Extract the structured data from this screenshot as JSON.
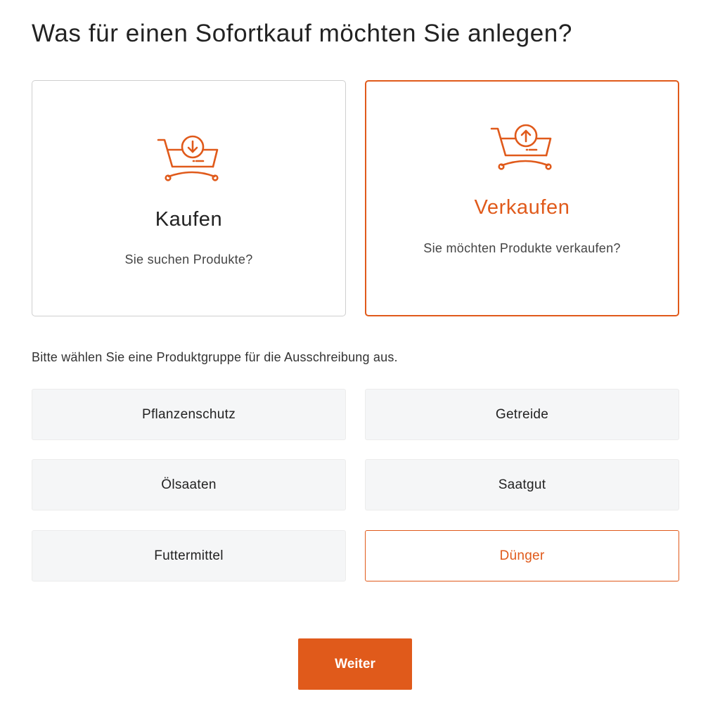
{
  "page": {
    "title": "Was für einen Sofortkauf möchten Sie anlegen?"
  },
  "options": {
    "buy": {
      "title": "Kaufen",
      "subtitle": "Sie suchen Produkte?",
      "icon": "cart-download-icon",
      "selected": false
    },
    "sell": {
      "title": "Verkaufen",
      "subtitle": "Sie möchten Produkte verkaufen?",
      "icon": "cart-upload-icon",
      "selected": true
    }
  },
  "product_groups": {
    "instruction": "Bitte wählen Sie eine Produktgruppe für die Ausschreibung aus.",
    "items": [
      {
        "label": "Pflanzenschutz",
        "selected": false
      },
      {
        "label": "Getreide",
        "selected": false
      },
      {
        "label": "Ölsaaten",
        "selected": false
      },
      {
        "label": "Saatgut",
        "selected": false
      },
      {
        "label": "Futtermittel",
        "selected": false
      },
      {
        "label": "Dünger",
        "selected": true
      }
    ]
  },
  "actions": {
    "next_label": "Weiter"
  },
  "colors": {
    "accent": "#e05a1b",
    "tile_background": "#f5f6f7",
    "card_border": "#cfcfcf"
  }
}
